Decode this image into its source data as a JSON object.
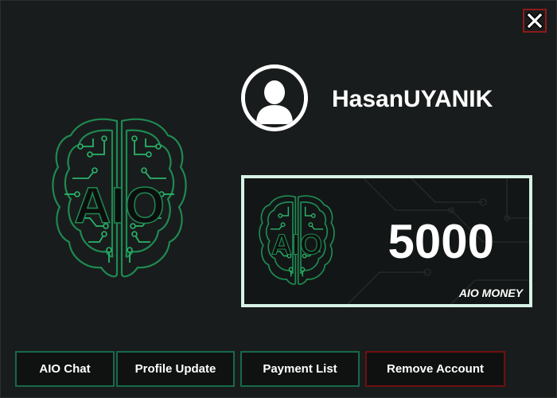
{
  "window": {
    "close_icon": "close-x-icon",
    "accent_color": "#17694a",
    "danger_color": "#8e1a1a"
  },
  "profile": {
    "avatar_icon": "user-avatar-icon",
    "username": "HasanUYANIK"
  },
  "logo": {
    "text": "AIO",
    "icon": "brain-circuit-icon",
    "color": "#1e8a52"
  },
  "wallet": {
    "amount": "5000",
    "currency_label": "AIO MONEY",
    "logo_text": "AIO"
  },
  "buttons": {
    "chat": "AIO Chat",
    "profile_update": "Profile Update",
    "payment_list": "Payment List",
    "remove_account": "Remove Account"
  }
}
